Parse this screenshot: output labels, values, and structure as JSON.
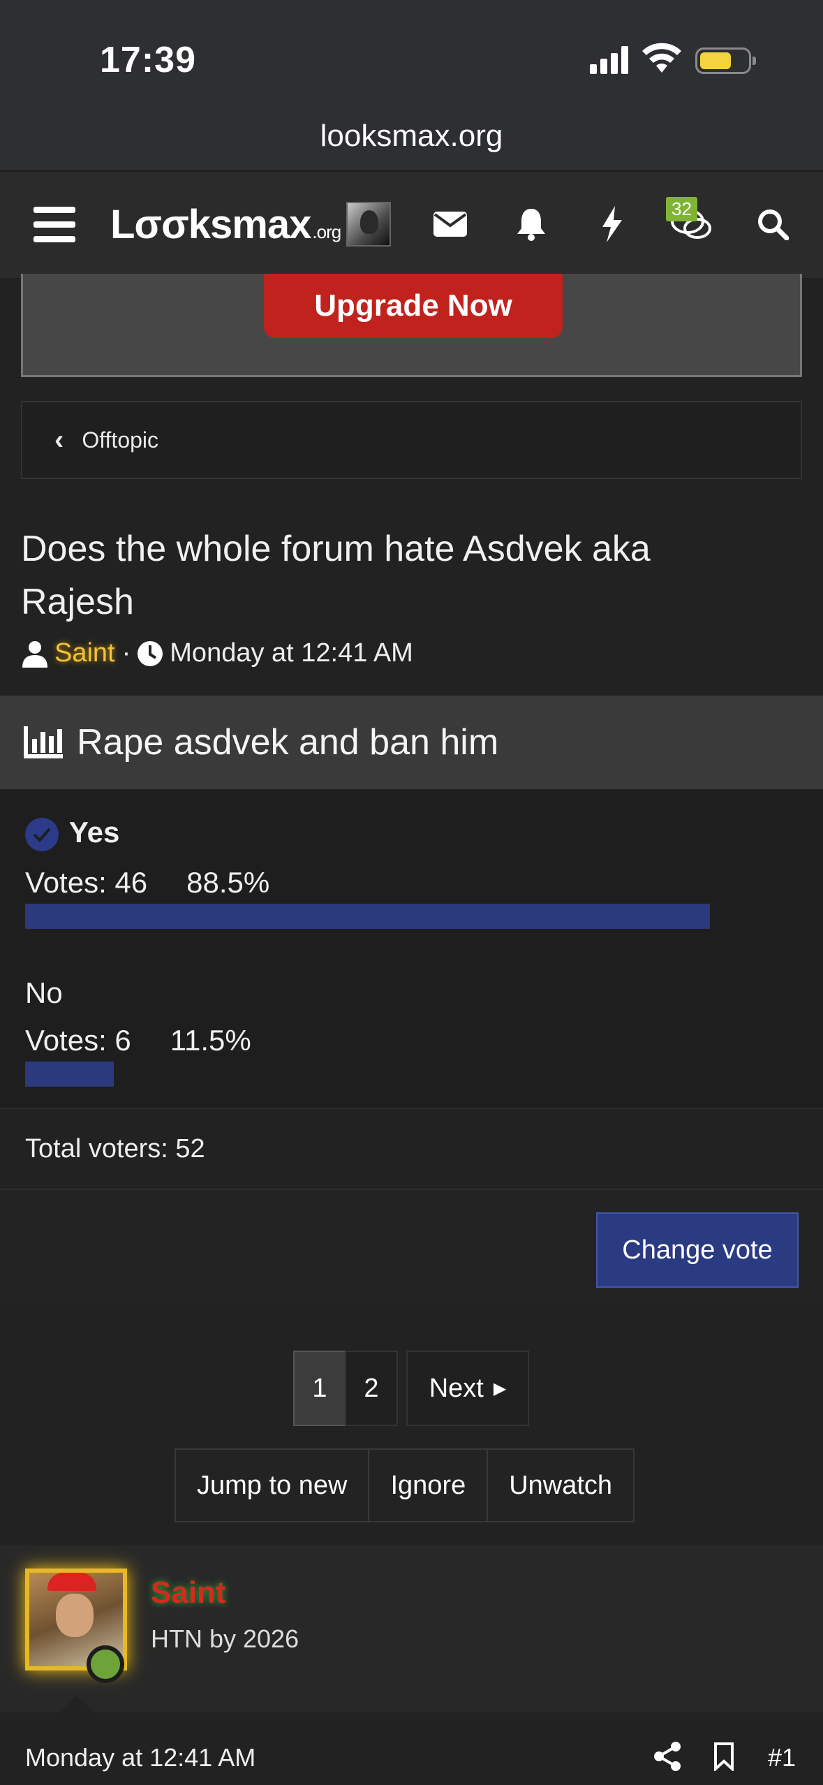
{
  "status_bar": {
    "time": "17:39"
  },
  "browser": {
    "url": "looksmax.org"
  },
  "header": {
    "logo_text": "Lσσksmax",
    "logo_suffix": ".org",
    "messages_badge": "32"
  },
  "banner": {
    "upgrade_label": "Upgrade Now"
  },
  "breadcrumb": {
    "label": "Offtopic"
  },
  "thread": {
    "title": "Does the whole forum hate Asdvek aka Rajesh",
    "author": "Saint",
    "separator": "·",
    "date": "Monday at 12:41 AM"
  },
  "poll": {
    "question": "Rape asdvek and ban him",
    "choices": [
      {
        "label": "Yes",
        "votes_text": "Votes: 46",
        "percent_text": "88.5%",
        "percent": 88.5,
        "selected": true
      },
      {
        "label": "No",
        "votes_text": "Votes: 6",
        "percent_text": "11.5%",
        "percent": 11.5,
        "selected": false
      }
    ],
    "total_voters": "Total voters: 52",
    "change_vote_label": "Change vote"
  },
  "pagination": {
    "pages": [
      "1",
      "2"
    ],
    "next_label": "Next"
  },
  "thread_actions": {
    "jump": "Jump to new",
    "ignore": "Ignore",
    "unwatch": "Unwatch"
  },
  "post": {
    "username": "Saint",
    "user_title": "HTN by 2026",
    "date": "Monday at 12:41 AM",
    "number": "#1"
  },
  "colors": {
    "accent_blue": "#2a3a7c",
    "upgrade_red": "#c0231d",
    "badge_green": "#7fb435",
    "author_gold": "#f0c23c"
  }
}
